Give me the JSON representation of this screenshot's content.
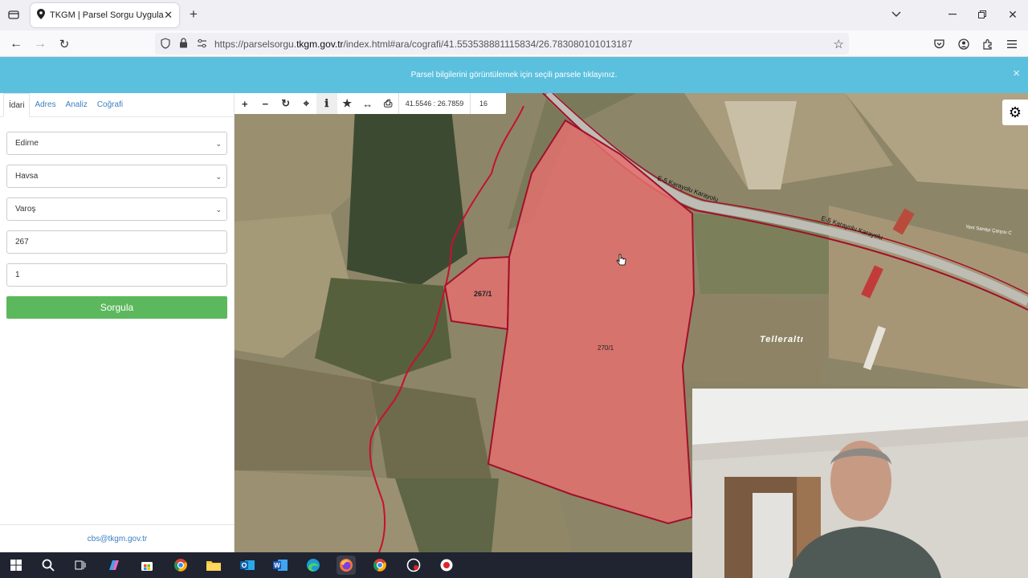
{
  "browser": {
    "tab_title": "TKGM | Parsel Sorgu Uygulama",
    "new_tab": "+",
    "url_prefix": "https://parselsorgu.",
    "url_domain": "tkgm.gov.tr",
    "url_rest": "/index.html#ara/cografi/41.553538881115834/26.783080101013187"
  },
  "banner": {
    "message": "Parsel bilgilerini görüntülemek için seçili parsele tıklayınız.",
    "close": "×"
  },
  "sidebar": {
    "tabs": [
      "İdari",
      "Adres",
      "Analiz",
      "Coğrafi"
    ],
    "province": "Edirne",
    "district": "Havsa",
    "neighborhood": "Varoş",
    "block": "267",
    "parcel": "1",
    "submit_label": "Sorgula",
    "footer_email": "cbs@tkgm.gov.tr"
  },
  "map": {
    "coordinates": "41.5546 : 26.7859",
    "zoom": "16",
    "parcel_labels": [
      "267/1",
      "270/1"
    ],
    "place_label": "Telleraltı",
    "road_labels": [
      "E-5 Karayolu Karayolu",
      "E-5 Karayolu Karayolu",
      "Yeni Sanayi Çarşısı C"
    ]
  },
  "colors": {
    "banner": "#5bc0de",
    "submit": "#5cb85c",
    "link": "#3a7fc1",
    "parcel_fill": "#e3706f",
    "parcel_stroke": "#a0102a"
  },
  "taskbar": {
    "icons": [
      "windows-icon",
      "search-icon",
      "task-view-icon",
      "copilot-icon",
      "store-icon",
      "chrome-icon",
      "explorer-icon",
      "outlook-icon",
      "word-icon",
      "edge-icon",
      "firefox-icon",
      "chrome-icon",
      "app-icon",
      "app-icon"
    ]
  }
}
